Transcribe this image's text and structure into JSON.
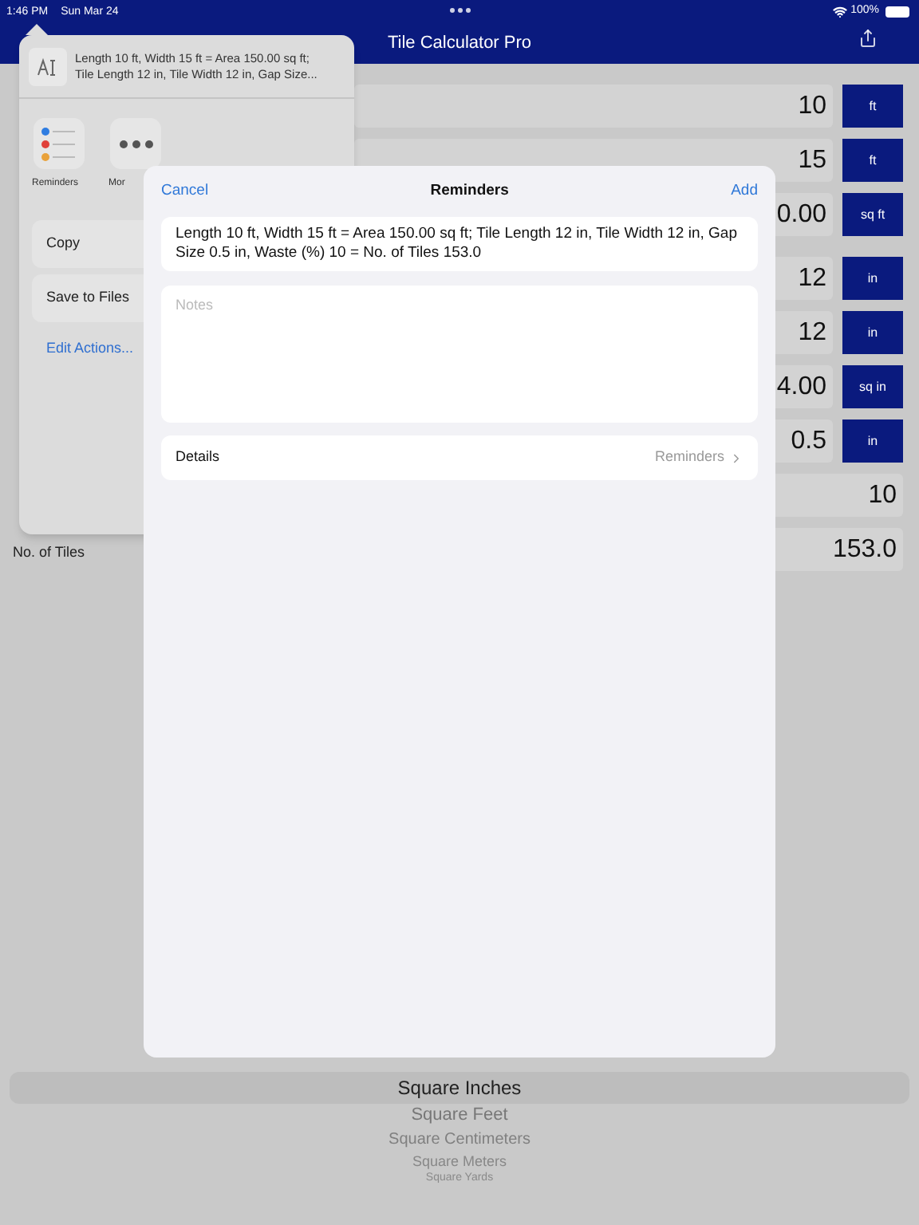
{
  "status_bar": {
    "time": "1:46 PM",
    "date": "Sun Mar 24",
    "battery": "100%"
  },
  "nav_bar": {
    "title": "Tile Calculator Pro"
  },
  "rows": [
    {
      "value": "10",
      "unit": "ft"
    },
    {
      "value": "15",
      "unit": "ft"
    },
    {
      "value": "0.00",
      "unit": "sq ft"
    },
    {
      "value": "12",
      "unit": "in"
    },
    {
      "value": "12",
      "unit": "in"
    },
    {
      "value": "4.00",
      "unit": "sq in"
    },
    {
      "value": "0.5",
      "unit": "in"
    },
    {
      "value": "10"
    },
    {
      "label": "No. of Tiles",
      "value": "153.0"
    }
  ],
  "picker": {
    "items": [
      {
        "label": "Square Inches",
        "selected": true
      },
      {
        "label": "Square Feet",
        "selected": false
      },
      {
        "label": "Square Centimeters",
        "selected": false
      },
      {
        "label": "Square Meters",
        "selected": false
      },
      {
        "label": "Square Yards",
        "selected": false
      }
    ]
  },
  "share_sheet": {
    "preview_lines": [
      "Length 10 ft, Width 15 ft = Area 150.00 sq ft;",
      "Tile Length 12 in, Tile Width 12 in, Gap Size..."
    ],
    "apps": [
      {
        "label": "Reminders",
        "kind": "reminders"
      },
      {
        "label": "Mor",
        "kind": "more"
      }
    ],
    "actions": [
      {
        "label": "Copy",
        "kind": "cell"
      },
      {
        "label": "Save to Files",
        "kind": "cell"
      },
      {
        "label": "Edit Actions...",
        "kind": "link"
      }
    ]
  },
  "modal": {
    "cancel": "Cancel",
    "title": "Reminders",
    "add": "Add",
    "text": "Length 10 ft, Width 15 ft = Area 150.00 sq ft; Tile Length 12 in, Tile Width 12 in, Gap Size 0.5 in, Waste (%) 10 = No. of Tiles 153.0",
    "notes_placeholder": "Notes",
    "details_label": "Details",
    "details_value": "Reminders"
  }
}
